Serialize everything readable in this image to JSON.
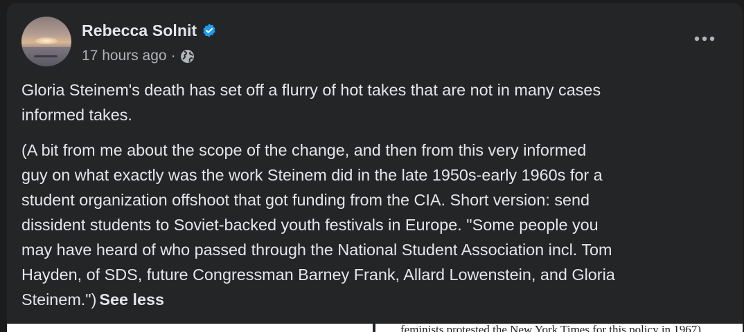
{
  "post": {
    "author": "Rebecca Solnit",
    "timestamp": "17 hours ago",
    "separator": "·",
    "verified_icon": "verified-badge-icon",
    "audience_icon": "globe-icon",
    "menu_icon": "more-options-icon",
    "paragraphs": {
      "p1": [
        "Gloria Steinem's death has set off a flurry of hot takes that are not in many cases",
        "informed takes."
      ],
      "p2": [
        "(A bit from me about the scope of the change, and then from this very informed",
        "guy on what exactly was the work Steinem did in the late 1950s-early 1960s for a",
        "student organization offshoot that got funding from the CIA. Short version: send",
        "dissident students to Soviet-backed youth festivals in Europe. \"Some people you",
        "may have heard of who passed through the National Student Association incl. Tom",
        "Hayden, of SDS, future Congressman Barney Frank, Allard Lowenstein, and Gloria",
        "Steinem.\")"
      ]
    },
    "see_less_label": "See less",
    "attachment_snippet": "feminists protested the New York Times for this policy in 1967)"
  },
  "colors": {
    "background": "#242526",
    "text": "#e4e6eb",
    "secondary_text": "#b0b3b8",
    "verified_blue": "#1d9bf0"
  }
}
